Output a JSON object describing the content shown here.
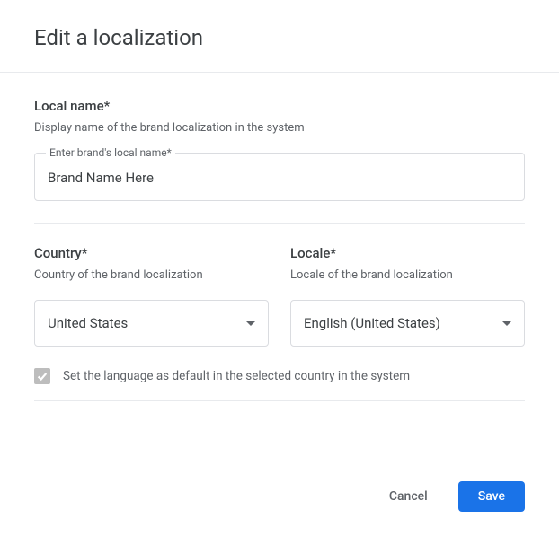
{
  "dialog": {
    "title": "Edit a localization"
  },
  "localName": {
    "label": "Local name*",
    "hint": "Display name of the brand localization in the system",
    "floatingLabel": "Enter brand's local name*",
    "value": "Brand Name Here"
  },
  "country": {
    "label": "Country*",
    "hint": "Country of the brand localization",
    "selected": "United States"
  },
  "locale": {
    "label": "Locale*",
    "hint": "Locale of the brand localization",
    "selected": "English (United States)"
  },
  "defaultLang": {
    "label": "Set the language as default in the selected country in the system",
    "checked": true
  },
  "actions": {
    "cancel": "Cancel",
    "save": "Save"
  }
}
